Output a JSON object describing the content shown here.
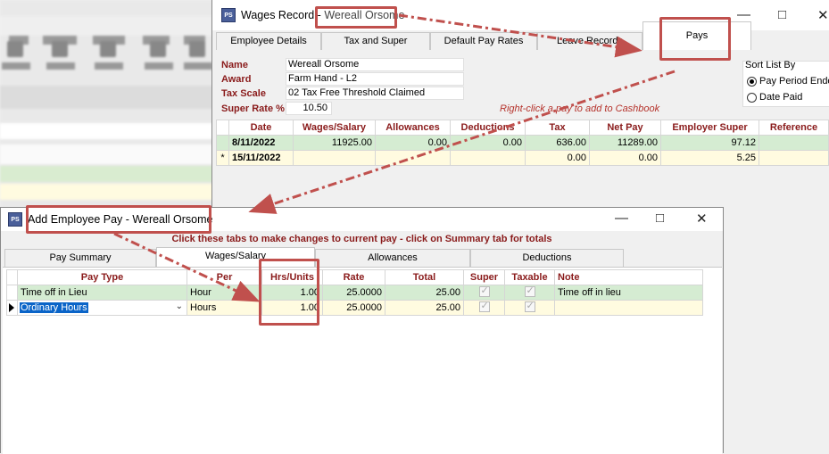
{
  "wages_window": {
    "title_prefix": "Wages Record - ",
    "title_name": "Wereall Orsome",
    "icon_text": "PS",
    "tabs": [
      "Employee Details",
      "Tax and Super",
      "Default Pay Rates",
      "Leave Records",
      "Pays"
    ],
    "active_tab": "Pays",
    "info": {
      "name_label": "Name",
      "name_value": "Wereall Orsome",
      "award_label": "Award",
      "award_value": "Farm Hand - L2",
      "taxscale_label": "Tax Scale",
      "taxscale_value": "02 Tax Free Threshold Claimed",
      "super_label": "Super Rate %",
      "super_value": "10.50"
    },
    "sort": {
      "label": "Sort List By",
      "options": [
        "Pay Period Ended",
        "Date Paid"
      ],
      "selected": "Pay Period Ended"
    },
    "right_click_hint": "Right-click a pay to add to Cashbook",
    "pays_table": {
      "columns": [
        "Date",
        "Wages/Salary",
        "Allowances",
        "Deductions",
        "Tax",
        "Net Pay",
        "Employer Super",
        "Reference"
      ],
      "rows": [
        {
          "marker": "",
          "date": "8/11/2022",
          "wages": "11925.00",
          "allowances": "0.00",
          "deductions": "0.00",
          "tax": "636.00",
          "net": "11289.00",
          "super": "97.12",
          "reference": ""
        },
        {
          "marker": "*",
          "date": "15/11/2022",
          "wages": "",
          "allowances": "",
          "deductions": "",
          "tax": "0.00",
          "net": "0.00",
          "super": "5.25",
          "reference": ""
        }
      ]
    }
  },
  "pay_window": {
    "title": "Add Employee Pay - Wereall Orsome",
    "icon_text": "PS",
    "hint": "Click these tabs to make changes to current pay - click on Summary tab for totals",
    "tabs": [
      "Pay Summary",
      "Wages/Salary",
      "Allowances",
      "Deductions"
    ],
    "active_tab": "Wages/Salary",
    "columns": [
      "Pay Type",
      "Per",
      "Hrs/Units",
      "Rate",
      "Total",
      "Super",
      "Taxable",
      "Note"
    ],
    "rows": [
      {
        "pay_type": "Time off in Lieu",
        "per": "Hour",
        "hrs": "1.00",
        "rate": "25.0000",
        "total": "25.00",
        "super": true,
        "taxable": true,
        "note": "Time off in lieu"
      },
      {
        "pay_type": "Ordinary Hours",
        "per": "Hours",
        "hrs": "1.00",
        "rate": "25.0000",
        "total": "25.00",
        "super": true,
        "taxable": true,
        "note": ""
      }
    ]
  },
  "colors": {
    "header_text": "#8a1b1b",
    "row_green": "#d5ecd2",
    "row_yellow": "#fffbe0",
    "annotation": "#c0504d"
  }
}
